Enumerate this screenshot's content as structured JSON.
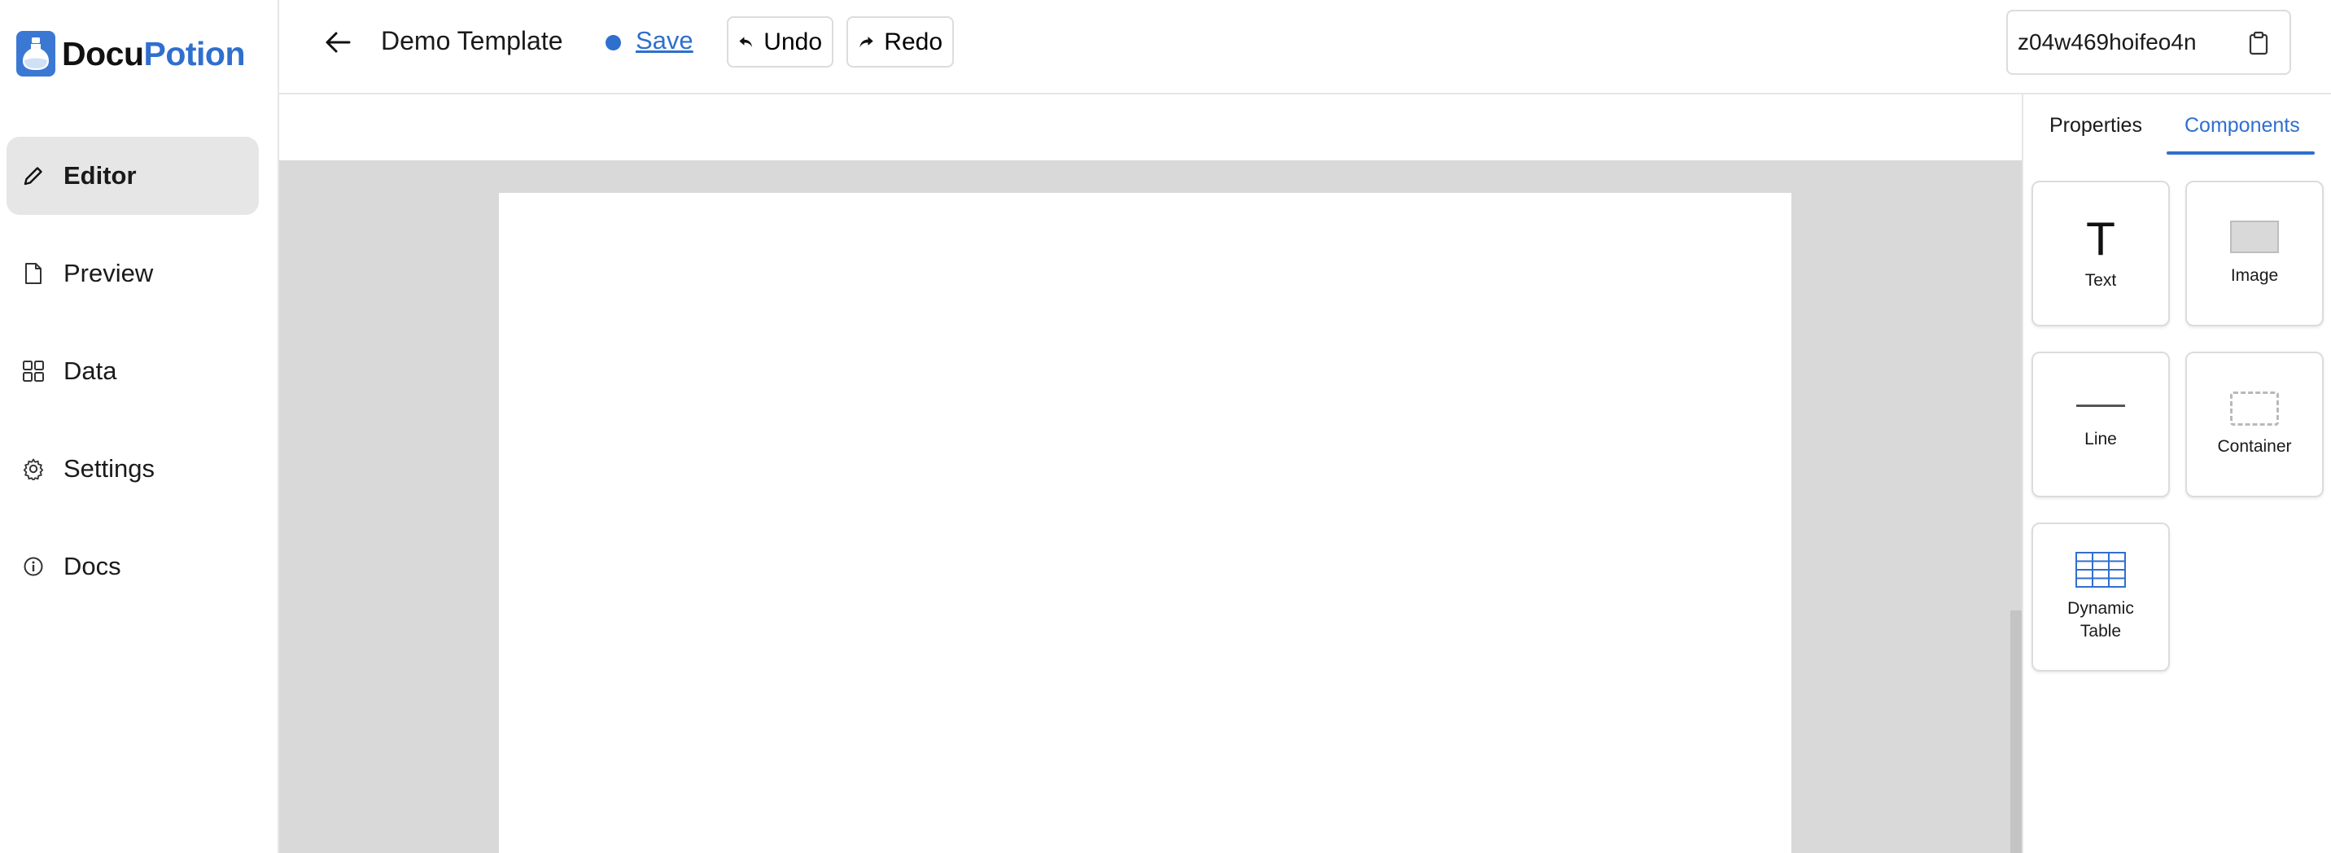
{
  "brand": {
    "name_part1": "Docu",
    "name_part2": "Potion",
    "logo_icon": "potion-flask-icon",
    "accent": "#2f6fce"
  },
  "sidebar": {
    "items": [
      {
        "label": "Editor",
        "icon": "pencil-icon",
        "active": true
      },
      {
        "label": "Preview",
        "icon": "document-icon",
        "active": false
      },
      {
        "label": "Data",
        "icon": "grid-icon",
        "active": false
      },
      {
        "label": "Settings",
        "icon": "gear-icon",
        "active": false
      },
      {
        "label": "Docs",
        "icon": "info-icon",
        "active": false
      }
    ]
  },
  "topbar": {
    "title": "Demo Template",
    "save_label": "Save",
    "undo_label": "Undo",
    "redo_label": "Redo",
    "template_id": "z04w469hoifeo4n"
  },
  "panel": {
    "tabs": [
      {
        "label": "Properties",
        "active": false
      },
      {
        "label": "Components",
        "active": true
      }
    ],
    "components": [
      {
        "label": "Text",
        "icon": "text-T-icon"
      },
      {
        "label": "Image",
        "icon": "image-placeholder-icon"
      },
      {
        "label": "Line",
        "icon": "line-icon"
      },
      {
        "label": "Container",
        "icon": "container-dashed-icon"
      },
      {
        "label_line1": "Dynamic",
        "label_line2": "Table",
        "icon": "table-grid-icon"
      }
    ]
  }
}
